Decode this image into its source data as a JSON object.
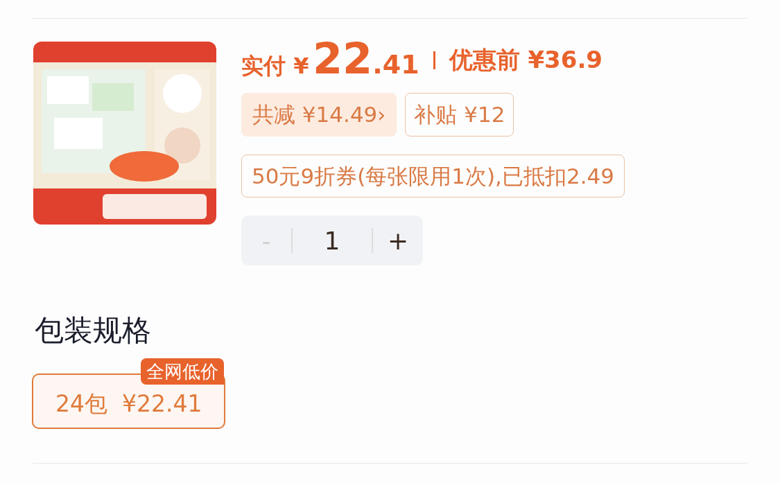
{
  "product": {
    "price": {
      "label": "实付",
      "currency": "¥",
      "integer": "22",
      "decimal": ".41"
    },
    "original_price": {
      "label": "优惠前",
      "value": "¥36.9"
    },
    "tags": [
      {
        "kind": "discount",
        "text": "共减 ¥14.49",
        "chevron": "›"
      },
      {
        "kind": "subsidy",
        "text": "补贴 ¥12"
      }
    ],
    "coupon": "50元9折券(每张限用1次),已抵扣2.49",
    "quantity": {
      "minus": "-",
      "minus_disabled": true,
      "value": "1",
      "plus": "+"
    }
  },
  "spec_section": {
    "title": "包装规格",
    "options": [
      {
        "label": "24包",
        "price": "¥22.41",
        "badge": "全网低价",
        "selected": true
      }
    ]
  }
}
